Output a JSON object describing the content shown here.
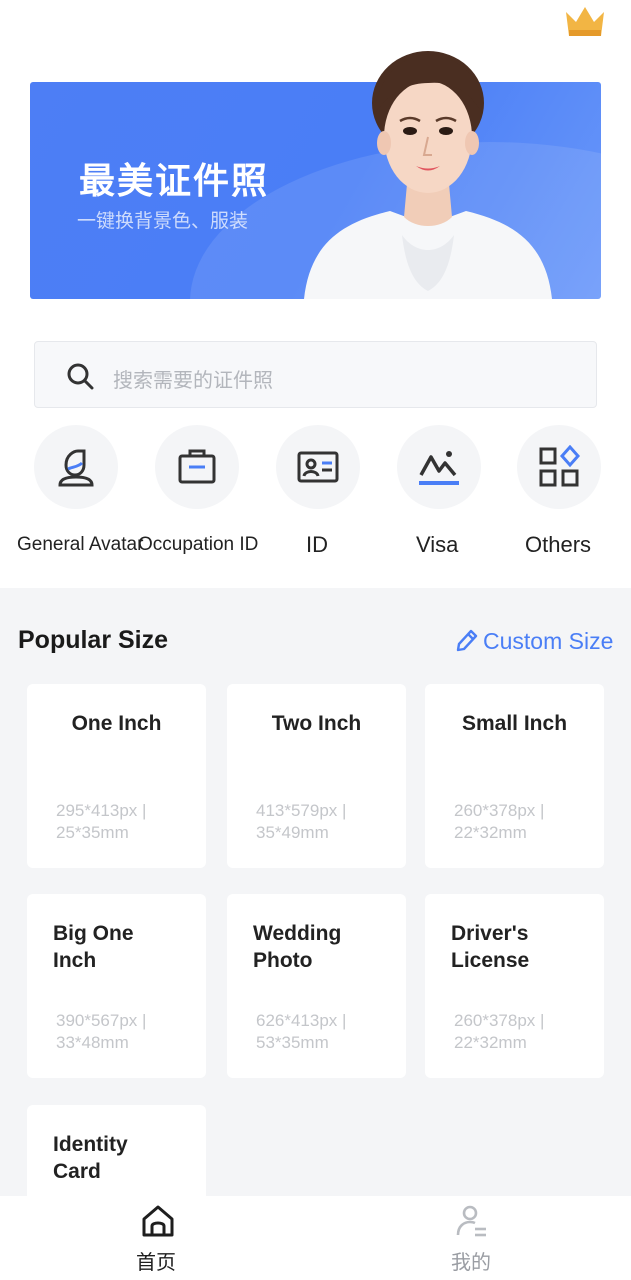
{
  "header": {
    "vip_icon": "crown-icon",
    "vip_color": "#f2b544"
  },
  "banner": {
    "title": "最美证件照",
    "subtitle": "一键换背景色、服装",
    "color": "#4d7ef5"
  },
  "search": {
    "placeholder": "搜索需要的证件照",
    "icon": "search-icon"
  },
  "categories": [
    {
      "label": "General Avatar",
      "icon": "avatar-icon"
    },
    {
      "label": "Occupation ID",
      "icon": "briefcase-icon"
    },
    {
      "label": "ID",
      "icon": "id-card-icon"
    },
    {
      "label": "Visa",
      "icon": "landscape-icon"
    },
    {
      "label": "Others",
      "icon": "grid-apps-icon"
    }
  ],
  "popular": {
    "title": "Popular Size",
    "custom_label": "Custom Size",
    "accent": "#4a7ef6",
    "cards": [
      {
        "name": "One Inch",
        "dims": "295*413px | 25*35mm"
      },
      {
        "name": "Two Inch",
        "dims": "413*579px | 35*49mm"
      },
      {
        "name": "Small Inch",
        "dims": "260*378px | 22*32mm"
      },
      {
        "name": "Big One Inch",
        "dims": "390*567px | 33*48mm"
      },
      {
        "name": "Wedding Photo",
        "dims": "626*413px | 53*35mm"
      },
      {
        "name": "Driver's License",
        "dims": "260*378px | 22*32mm"
      },
      {
        "name": "Identity Card",
        "dims": ""
      }
    ]
  },
  "tabbar": {
    "items": [
      {
        "label": "首页",
        "icon": "home-icon",
        "active": true
      },
      {
        "label": "我的",
        "icon": "profile-icon",
        "active": false
      }
    ]
  }
}
